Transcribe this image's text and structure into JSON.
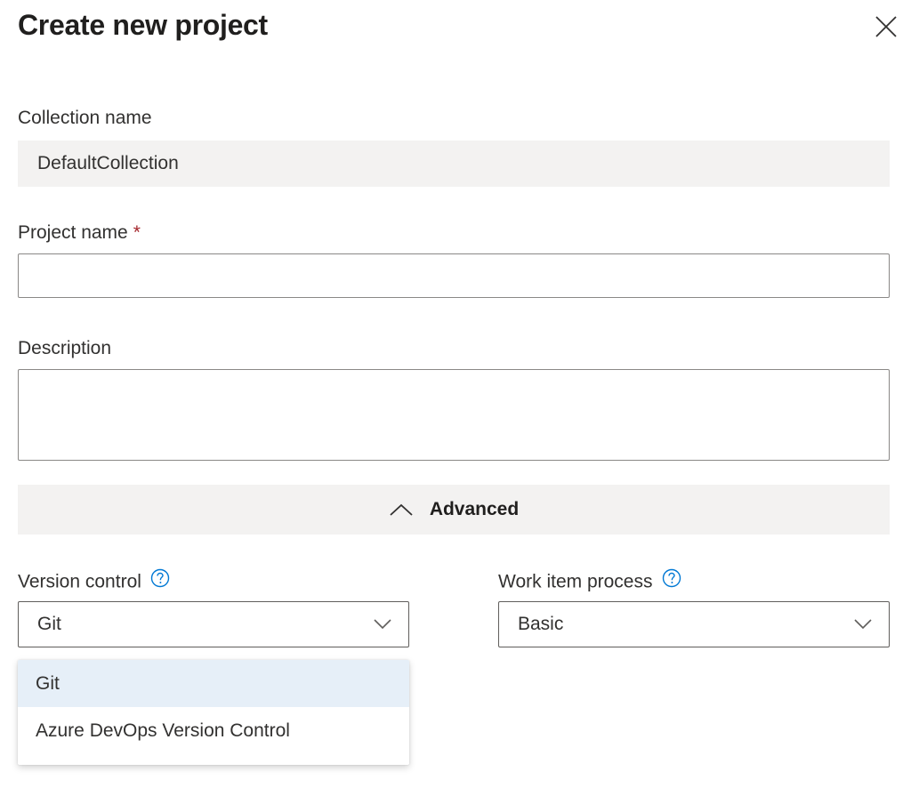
{
  "dialog": {
    "title": "Create new project",
    "close_icon": "close-icon"
  },
  "collection": {
    "label": "Collection name",
    "value": "DefaultCollection"
  },
  "project_name": {
    "label": "Project name",
    "required_marker": "*",
    "value": "",
    "placeholder": ""
  },
  "description": {
    "label": "Description",
    "value": "",
    "placeholder": ""
  },
  "advanced": {
    "label": "Advanced",
    "icon": "chevron-up-icon",
    "expanded": true
  },
  "version_control": {
    "label": "Version control",
    "help_icon": "help-icon",
    "selected": "Git",
    "options": [
      "Git",
      "Azure DevOps Version Control"
    ],
    "open": true
  },
  "work_item_process": {
    "label": "Work item process",
    "help_icon": "help-icon",
    "selected": "Basic"
  },
  "colors": {
    "accent": "#0078d4",
    "required": "#a4262c",
    "field_bg": "#f3f2f1",
    "selected_option_bg": "#e6eff8"
  }
}
